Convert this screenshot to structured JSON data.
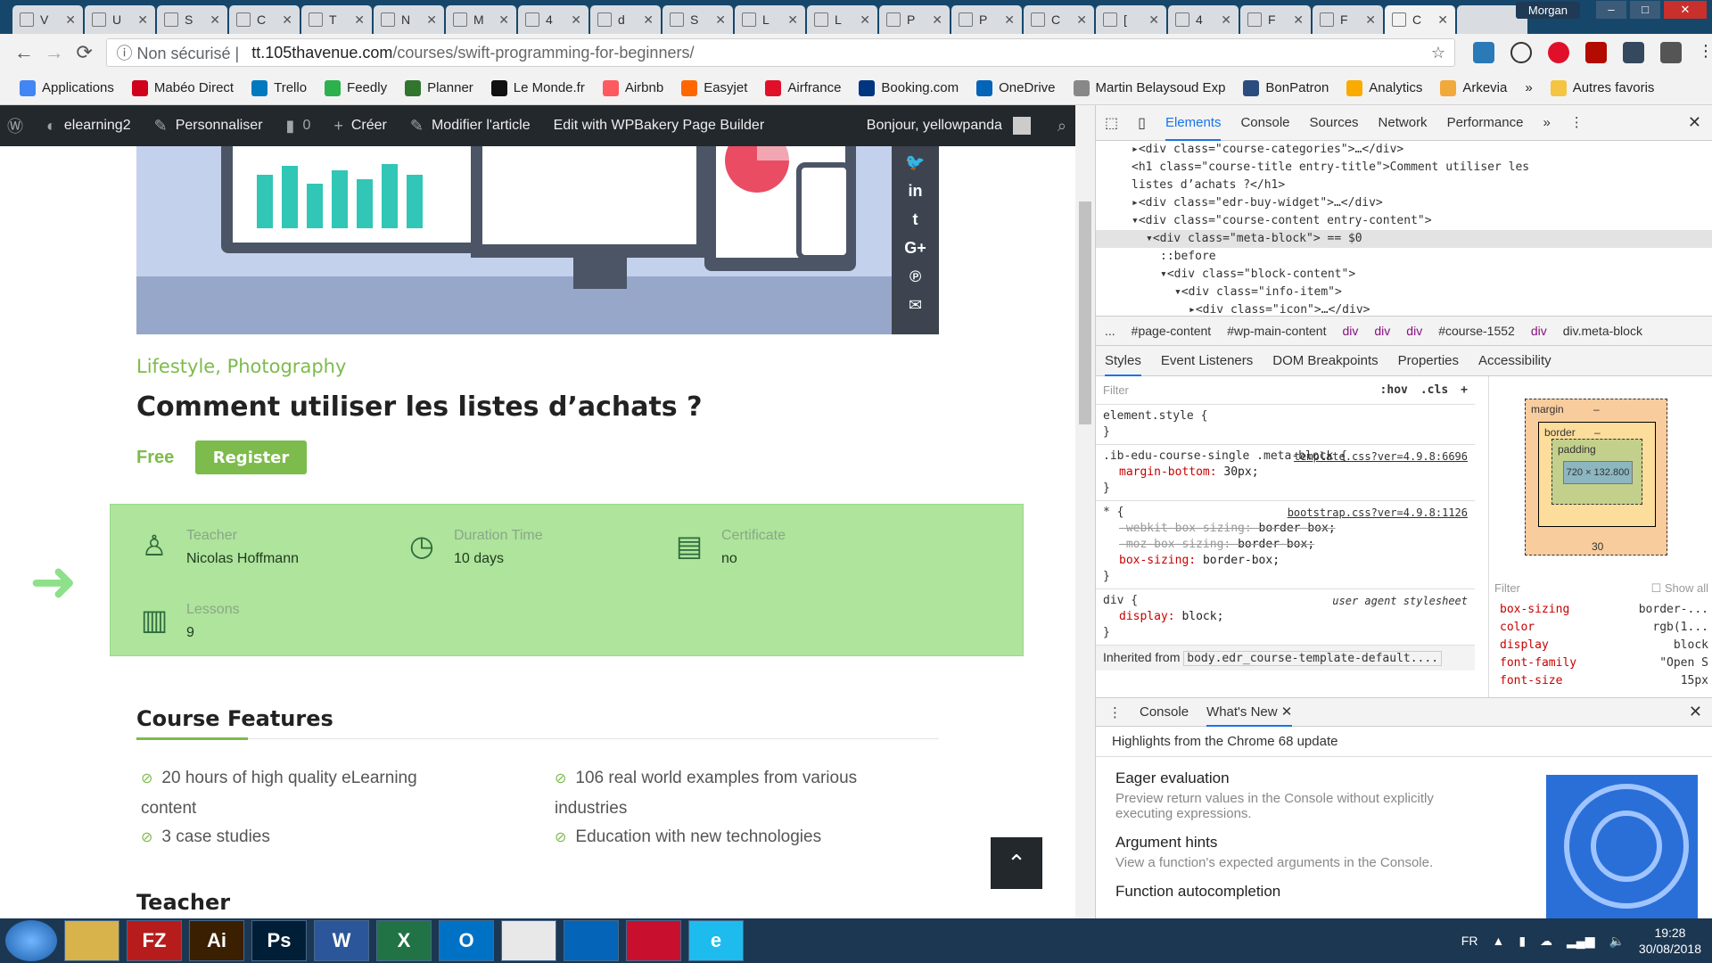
{
  "browser": {
    "tabs": [
      {
        "label": "V"
      },
      {
        "label": "U"
      },
      {
        "label": "S"
      },
      {
        "label": "C"
      },
      {
        "label": "T"
      },
      {
        "label": "N"
      },
      {
        "label": "M"
      },
      {
        "label": "4"
      },
      {
        "label": "d"
      },
      {
        "label": "S"
      },
      {
        "label": "L"
      },
      {
        "label": "L"
      },
      {
        "label": "P"
      },
      {
        "label": "P"
      },
      {
        "label": "C"
      },
      {
        "label": "["
      },
      {
        "label": "4"
      },
      {
        "label": "F"
      },
      {
        "label": "F"
      },
      {
        "label": "C"
      }
    ],
    "profile_name": "Morgan",
    "security_label": "Non sécurisé",
    "url_host": "tt.105thavenue.com",
    "url_path": "/courses/swift-programming-for-beginners/",
    "bookmarks": [
      {
        "label": "Applications",
        "color": "#4285f4"
      },
      {
        "label": "Mabéo Direct",
        "color": "#d0021b"
      },
      {
        "label": "Trello",
        "color": "#0079bf"
      },
      {
        "label": "Feedly",
        "color": "#2bb24c"
      },
      {
        "label": "Planner",
        "color": "#31752f"
      },
      {
        "label": "Le Monde.fr",
        "color": "#111111"
      },
      {
        "label": "Airbnb",
        "color": "#ff5a5f"
      },
      {
        "label": "Easyjet",
        "color": "#ff6600"
      },
      {
        "label": "Airfrance",
        "color": "#e0102a"
      },
      {
        "label": "Booking.com",
        "color": "#003580"
      },
      {
        "label": "OneDrive",
        "color": "#0364b8"
      },
      {
        "label": "Martin Belaysoud Exp",
        "color": "#888888"
      },
      {
        "label": "BonPatron",
        "color": "#2b4c7e"
      },
      {
        "label": "Analytics",
        "color": "#f9ab00"
      },
      {
        "label": "Arkevia",
        "color": "#f2a93b"
      }
    ],
    "bookmarks_more": "»",
    "other_bookmarks": "Autres favoris"
  },
  "wp_admin_bar": {
    "site": "elearning2",
    "customize": "Personnaliser",
    "comments_count": "0",
    "create": "Créer",
    "edit_post": "Modifier l'article",
    "wpbakery": "Edit with WPBakery Page Builder",
    "greeting": "Bonjour, yellowpanda"
  },
  "course": {
    "categories": [
      "Lifestyle",
      "Photography"
    ],
    "category_sep": ", ",
    "title": "Comment utiliser les listes d’achats ?",
    "price": "Free",
    "register_label": "Register",
    "info": [
      {
        "label": "Teacher",
        "value": "Nicolas Hoffmann",
        "icon": "teacher-icon"
      },
      {
        "label": "Duration Time",
        "value": "10 days",
        "icon": "clock-check-icon"
      },
      {
        "label": "Certificate",
        "value": "no",
        "icon": "certificate-icon"
      },
      {
        "label": "Lessons",
        "value": "9",
        "icon": "book-icon"
      }
    ],
    "features_heading": "Course Features",
    "features": [
      "20 hours of high quality eLearning content",
      "106 real world examples from various industries",
      "3 case studies",
      "Education with new technologies"
    ],
    "teacher_heading": "Teacher",
    "share_icons": [
      "twitter-icon",
      "linkedin-icon",
      "tumblr-icon",
      "google-plus-icon",
      "pinterest-icon",
      "email-icon"
    ],
    "accent_color": "#7dbb4c",
    "meta_bg": "#aee49b"
  },
  "devtools": {
    "tabs": [
      "Elements",
      "Console",
      "Sources",
      "Network",
      "Performance"
    ],
    "tabs_more": "»",
    "dom_lines": [
      {
        "indent": 0,
        "text": "▸<div class=\"course-categories\">…</div>"
      },
      {
        "indent": 0,
        "text": "<h1 class=\"course-title entry-title\">Comment utiliser les"
      },
      {
        "indent": 0,
        "text": "listes d’achats ?</h1>"
      },
      {
        "indent": 0,
        "text": "▸<div class=\"edr-buy-widget\">…</div>"
      },
      {
        "indent": 0,
        "text": "▾<div class=\"course-content entry-content\">"
      },
      {
        "indent": 1,
        "text": "▾<div class=\"meta-block\"> == $0"
      },
      {
        "indent": 2,
        "text": "::before"
      },
      {
        "indent": 2,
        "text": "▾<div class=\"block-content\">"
      },
      {
        "indent": 3,
        "text": "▾<div class=\"info-item\">"
      },
      {
        "indent": 4,
        "text": "▸<div class=\"icon\">…</div>"
      }
    ],
    "breadcrumbs": [
      "...",
      "#page-content",
      "#wp-main-content",
      "div",
      "div",
      "div",
      "#course-1552",
      "div",
      "div.meta-block"
    ],
    "sub_tabs": [
      "Styles",
      "Event Listeners",
      "DOM Breakpoints",
      "Properties",
      "Accessibility"
    ],
    "filter_placeholder": "Filter",
    "hov": ":hov",
    "cls": ".cls",
    "rules": [
      {
        "selector": "element.style {",
        "source": "",
        "props": []
      },
      {
        "selector": ".ib-edu-course-single .meta-block {",
        "source": "template.css?ver=4.9.8:6696",
        "props": [
          {
            "k": "margin-bottom",
            "v": "30px;",
            "strike": false
          }
        ]
      },
      {
        "selector": "* {",
        "source": "bootstrap.css?ver=4.9.8:1126",
        "props": [
          {
            "k": "-webkit-box-sizing",
            "v": "border-box;",
            "strike": true
          },
          {
            "k": "-moz-box-sizing",
            "v": "border-box;",
            "strike": true
          },
          {
            "k": "box-sizing",
            "v": "border-box;",
            "strike": false
          }
        ]
      },
      {
        "selector": "div {",
        "source": "user agent stylesheet",
        "props": [
          {
            "k": "display",
            "v": "block;",
            "strike": false
          }
        ]
      }
    ],
    "inherited_label": "Inherited from",
    "inherited_from": "body.edr_course-template-default....",
    "box_model": {
      "margin": "margin",
      "border": "border",
      "padding": "padding",
      "content": "720 × 132.800",
      "dash": "–",
      "margin_bottom": "30"
    },
    "computed_filter": "Filter",
    "show_all": "Show all",
    "computed": [
      {
        "k": "box-sizing",
        "v": "border-..."
      },
      {
        "k": "color",
        "v": "rgb(1..."
      },
      {
        "k": "display",
        "v": "block"
      },
      {
        "k": "font-family",
        "v": "\"Open S"
      },
      {
        "k": "font-size",
        "v": "15px"
      }
    ],
    "drawer_tabs": [
      "Console",
      "What's New"
    ],
    "highlights": "Highlights from the Chrome 68 update",
    "whats_new": [
      {
        "title": "Eager evaluation",
        "desc": "Preview return values in the Console without explicitly executing expressions."
      },
      {
        "title": "Argument hints",
        "desc": "View a function's expected arguments in the Console."
      },
      {
        "title": "Function autocompletion",
        "desc": ""
      }
    ]
  },
  "taskbar": {
    "apps": [
      {
        "label": "",
        "color": "#d8b24a"
      },
      {
        "label": "FZ",
        "color": "#b71c1c"
      },
      {
        "label": "Ai",
        "color": "#3a1f00"
      },
      {
        "label": "Ps",
        "color": "#001e36"
      },
      {
        "label": "W",
        "color": "#2b579a"
      },
      {
        "label": "X",
        "color": "#217346"
      },
      {
        "label": "O",
        "color": "#0072c6"
      },
      {
        "label": "",
        "color": "#e8e8e8"
      },
      {
        "label": "",
        "color": "#0364b8"
      },
      {
        "label": "",
        "color": "#c8102e"
      },
      {
        "label": "e",
        "color": "#1ebbee"
      }
    ],
    "lang": "FR",
    "time": "19:28",
    "date": "30/08/2018"
  }
}
